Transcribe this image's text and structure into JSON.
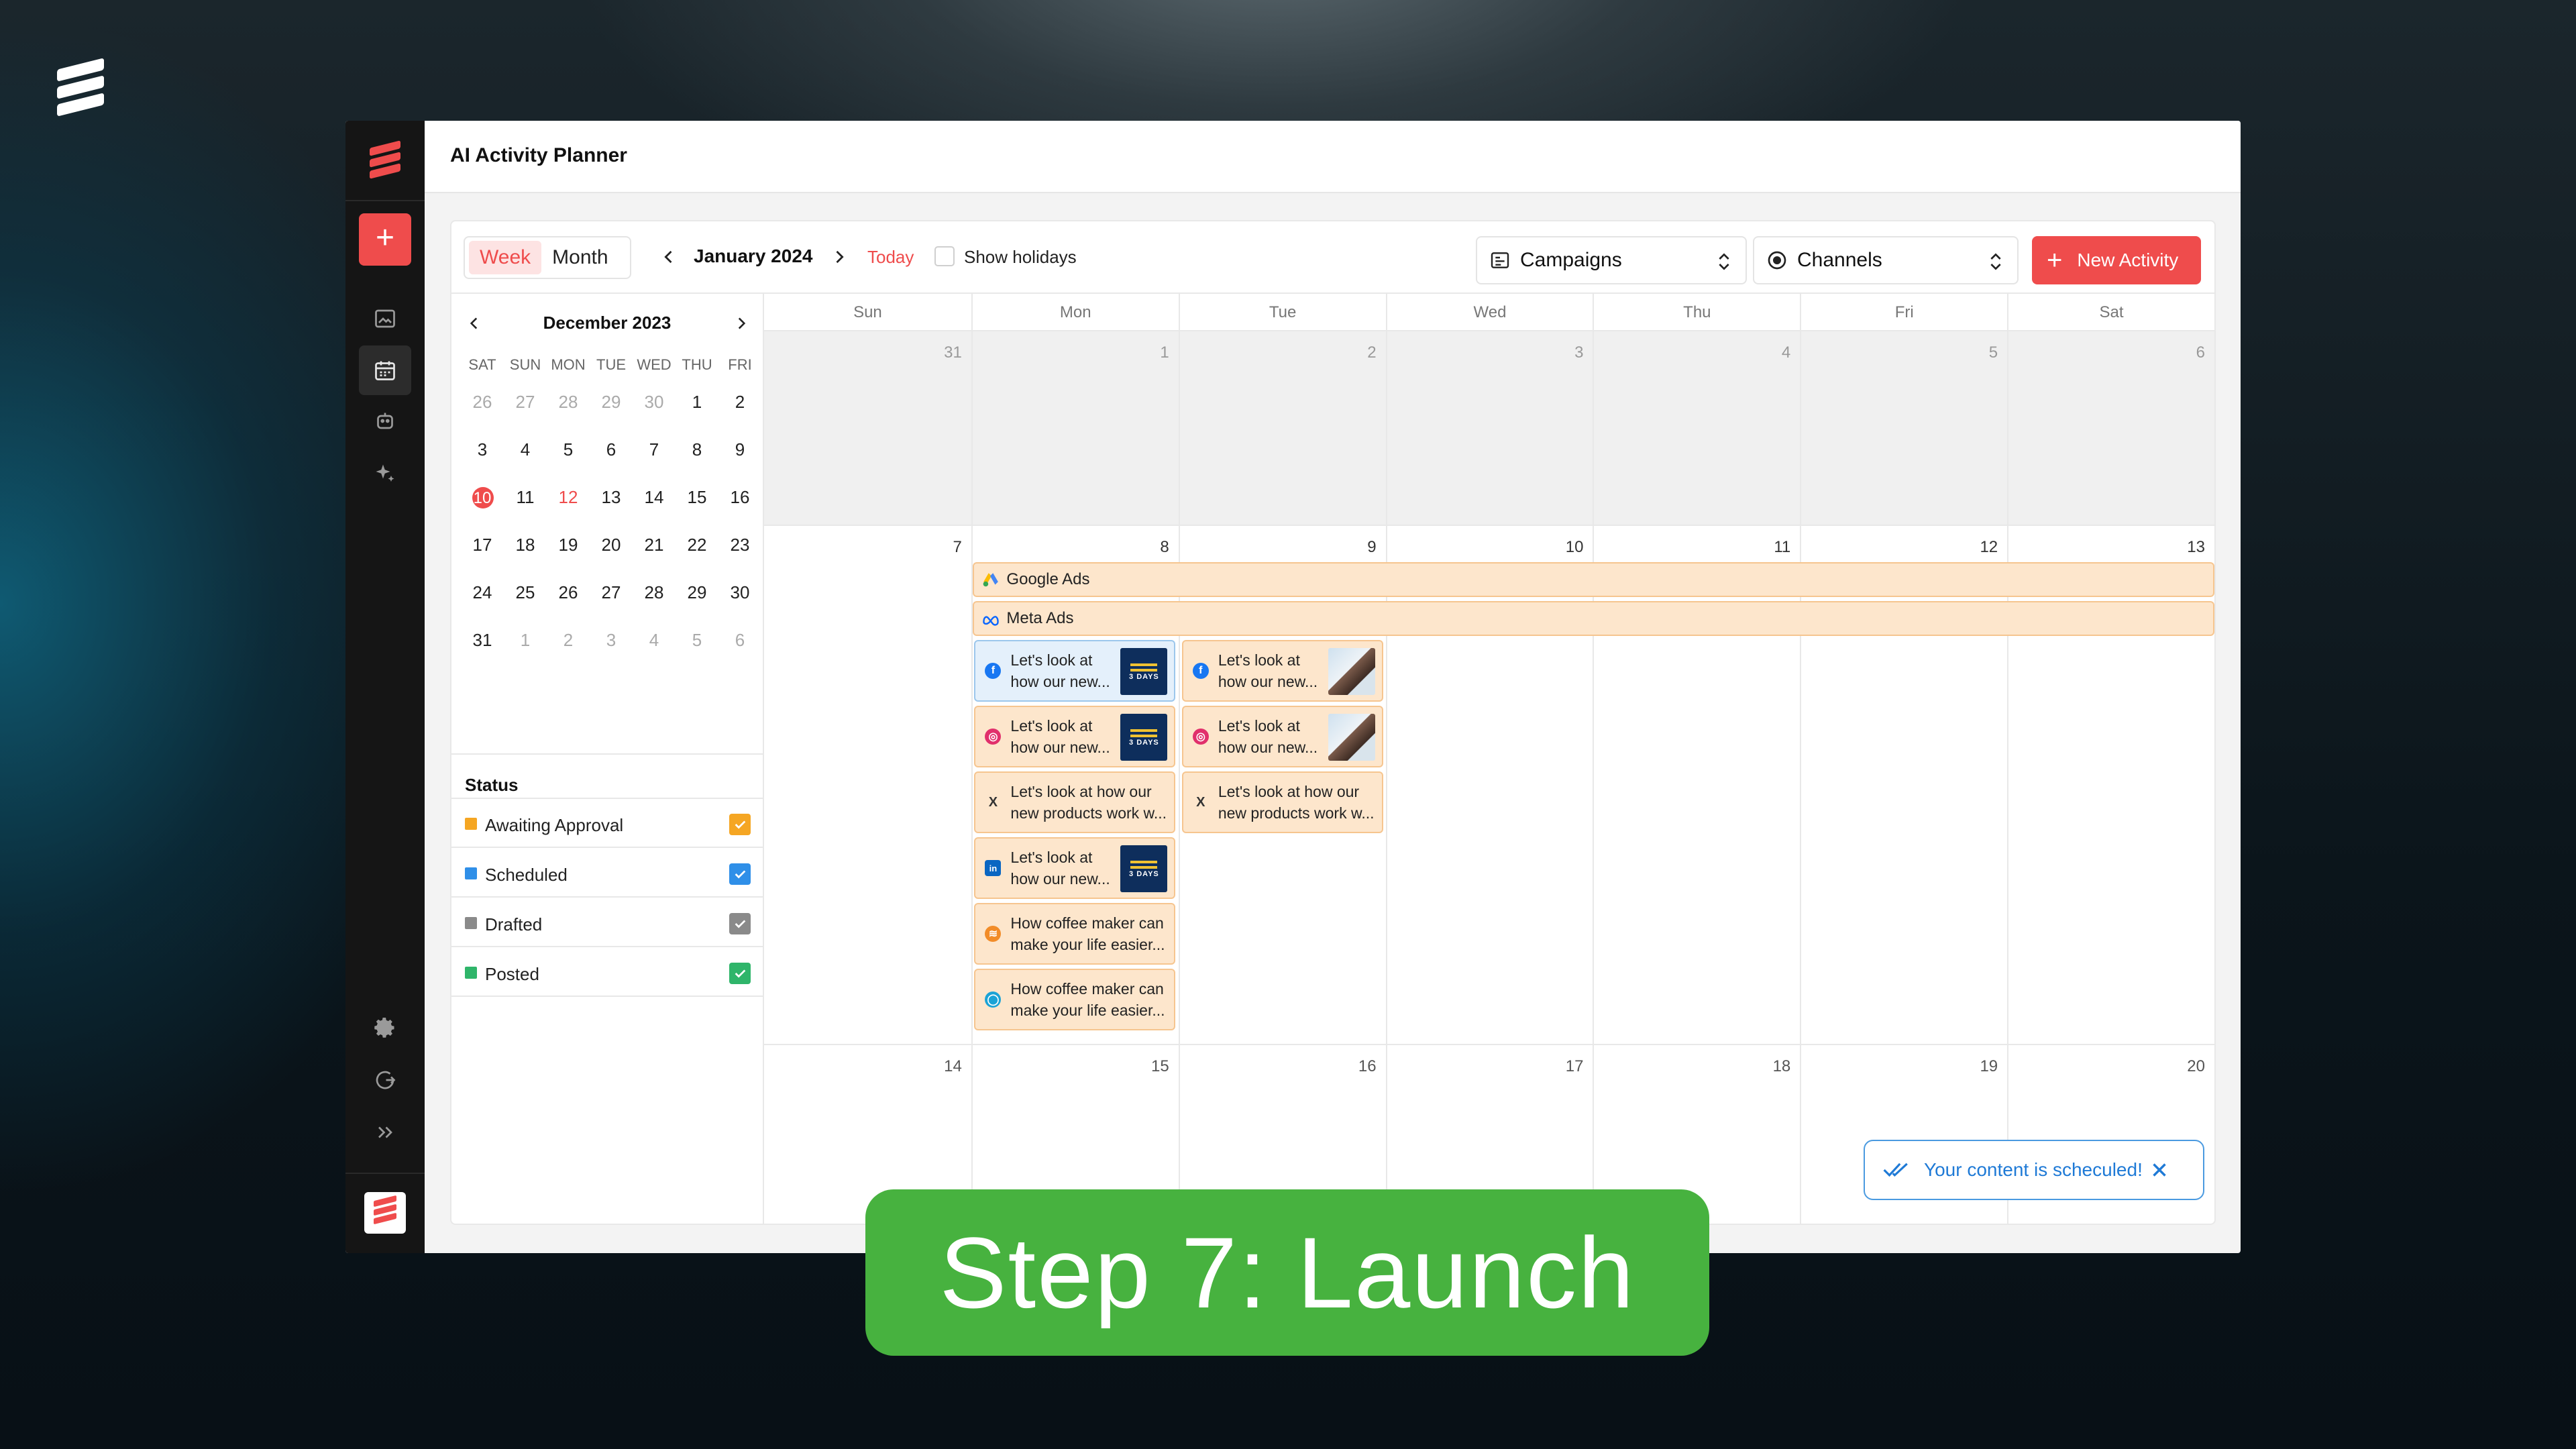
{
  "app": {
    "title": "AI Activity Planner"
  },
  "toolbar": {
    "view_options": [
      "Week",
      "Month"
    ],
    "active_view": "Week",
    "period": "January 2024",
    "today": "Today",
    "show_holidays": "Show holidays",
    "campaigns": "Campaigns",
    "channels": "Channels",
    "new_activity": "New Activity"
  },
  "mini_calendar": {
    "title": "December 2023",
    "dow": [
      "SAT",
      "SUN",
      "MON",
      "TUE",
      "WED",
      "THU",
      "FRI"
    ],
    "weeks": [
      [
        "26",
        "27",
        "28",
        "29",
        "30",
        "1",
        "2"
      ],
      [
        "3",
        "4",
        "5",
        "6",
        "7",
        "8",
        "9"
      ],
      [
        "10",
        "11",
        "12",
        "13",
        "14",
        "15",
        "16"
      ],
      [
        "17",
        "18",
        "19",
        "20",
        "21",
        "22",
        "23"
      ],
      [
        "24",
        "25",
        "26",
        "27",
        "28",
        "29",
        "30"
      ],
      [
        "31",
        "1",
        "2",
        "3",
        "4",
        "5",
        "6"
      ]
    ],
    "selected": "10",
    "highlight": "12"
  },
  "status": {
    "title": "Status",
    "items": [
      {
        "label": "Awaiting Approval",
        "color": "#f5a623"
      },
      {
        "label": "Scheduled",
        "color": "#2f8fe8"
      },
      {
        "label": "Drafted",
        "color": "#8a8a8a"
      },
      {
        "label": "Posted",
        "color": "#2fb56a"
      }
    ]
  },
  "calendar": {
    "days": [
      "Sun",
      "Mon",
      "Tue",
      "Wed",
      "Thu",
      "Fri",
      "Sat"
    ],
    "weeks": [
      [
        "31",
        "1",
        "2",
        "3",
        "4",
        "5",
        "6"
      ],
      [
        "7",
        "8",
        "9",
        "10",
        "11",
        "12",
        "13"
      ],
      [
        "14",
        "15",
        "16",
        "17",
        "18",
        "19",
        "20"
      ]
    ],
    "campaign_bars": [
      "Google Ads",
      "Meta Ads"
    ],
    "mon_cards": [
      {
        "icon": "facebook-icon",
        "text": "Let's look at how our new...",
        "thumb": "3 DAYS"
      },
      {
        "icon": "instagram-icon",
        "text": "Let's look at how our new...",
        "thumb": "3 DAYS"
      },
      {
        "icon": "x-icon",
        "text": "Let's look at how our new products work w..."
      },
      {
        "icon": "linkedin-icon",
        "text": "Let's look at how our new...",
        "thumb": "3 DAYS"
      },
      {
        "icon": "rss-icon",
        "text": "How coffee maker can make your life easier..."
      },
      {
        "icon": "chat-icon",
        "text": "How coffee maker can make your life easier..."
      }
    ],
    "tue_cards": [
      {
        "icon": "facebook-icon",
        "text": "Let's look at how our new..."
      },
      {
        "icon": "instagram-icon",
        "text": "Let's look at how our new..."
      },
      {
        "icon": "x-icon",
        "text": "Let's look at how our new products work w..."
      }
    ]
  },
  "toast": {
    "message": "Your content is scheculed!"
  },
  "banner": {
    "text": "Step 7: Launch"
  },
  "colors": {
    "accent": "#ef4c4c",
    "banner": "#47b23f"
  }
}
